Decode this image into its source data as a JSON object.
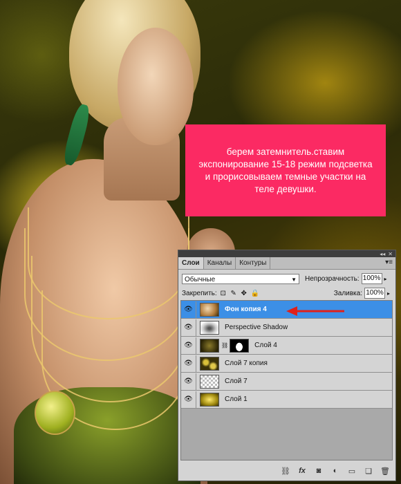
{
  "callout": {
    "text": "берем затемнитель.ставим экспонирование 15-18 режим подсветка и прорисовываем темные участки на  теле девушки."
  },
  "panel": {
    "tabs": [
      {
        "label": "Слои",
        "active": true
      },
      {
        "label": "Каналы",
        "active": false
      },
      {
        "label": "Контуры",
        "active": false
      }
    ],
    "blend_mode": "Обычные",
    "opacity_label": "Непрозрачность:",
    "opacity_value": "100%",
    "lock_label": "Закрепить:",
    "fill_label": "Заливка:",
    "fill_value": "100%",
    "layers": [
      {
        "name": "Фон копия 4",
        "selected": true,
        "visible": true,
        "thumb": "photo"
      },
      {
        "name": "Perspective Shadow",
        "selected": false,
        "visible": true,
        "thumb": "shadow"
      },
      {
        "name": "Слой 4",
        "selected": false,
        "visible": true,
        "thumb": "dark-with-mask"
      },
      {
        "name": "Слой 7 копия",
        "selected": false,
        "visible": true,
        "thumb": "flowers"
      },
      {
        "name": "Слой 7",
        "selected": false,
        "visible": true,
        "thumb": "transparent"
      },
      {
        "name": "Слой 1",
        "selected": false,
        "visible": true,
        "thumb": "glow"
      }
    ],
    "bottom_icons": [
      "link-icon",
      "fx-icon",
      "mask-icon",
      "adjustment-icon",
      "group-icon",
      "new-layer-icon",
      "trash-icon"
    ]
  },
  "colors": {
    "callout_bg": "#fb2a63",
    "selected_layer": "#3c8fe6",
    "arrow": "#e0201a"
  }
}
